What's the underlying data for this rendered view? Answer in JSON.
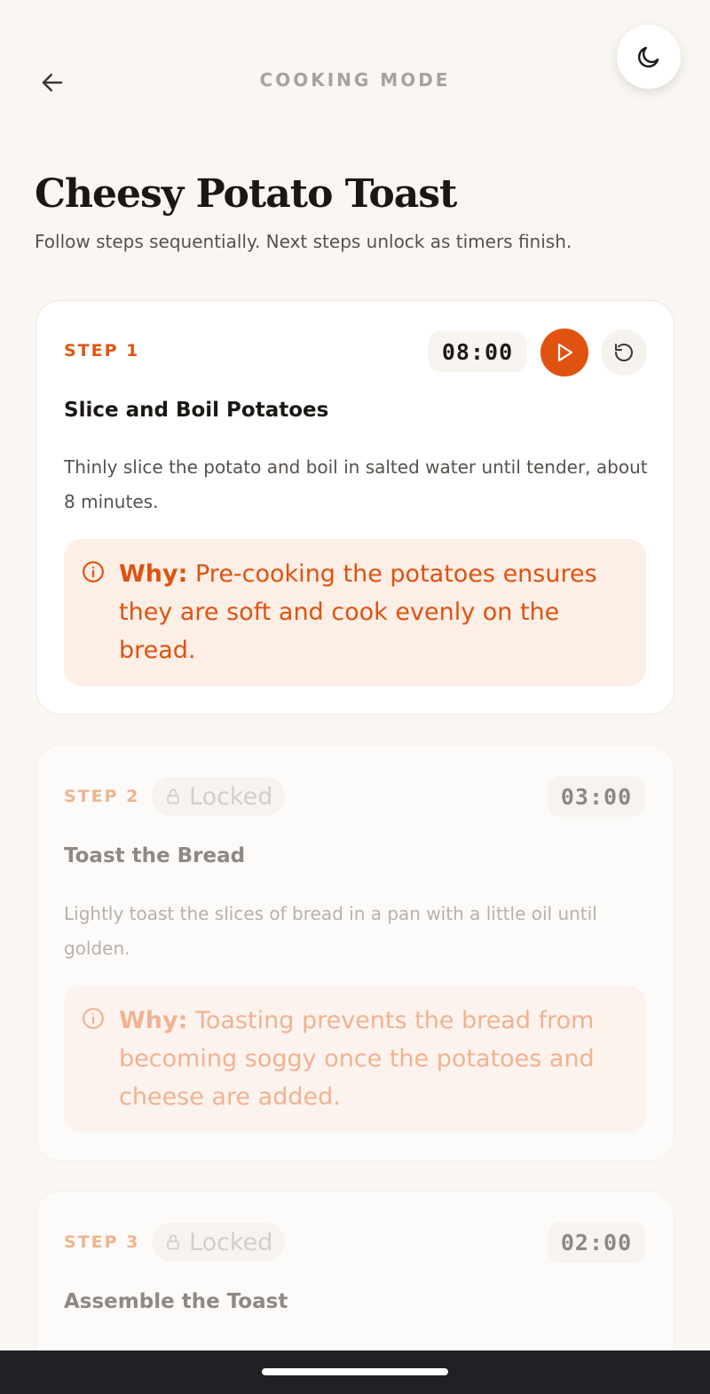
{
  "header": {
    "title": "COOKING MODE",
    "back_icon": "arrow-left-icon",
    "theme_icon": "moon-icon"
  },
  "recipe": {
    "title": "Cheesy Potato Toast",
    "subtitle": "Follow steps sequentially. Next steps unlock as timers finish."
  },
  "steps": [
    {
      "label": "STEP 1",
      "timer": "08:00",
      "title": "Slice and Boil Potatoes",
      "description": "Thinly slice the potato and boil in salted water until tender, about 8 minutes.",
      "why_label": "Why:",
      "why_text": "Pre-cooking the potatoes ensures they are soft and cook evenly on the bread."
    },
    {
      "label": "STEP 2",
      "locked_label": "Locked",
      "timer": "03:00",
      "title": "Toast the Bread",
      "description": "Lightly toast the slices of bread in a pan with a little oil until golden.",
      "why_label": "Why:",
      "why_text": "Toasting prevents the bread from becoming soggy once the potatoes and cheese are added."
    },
    {
      "label": "STEP 3",
      "locked_label": "Locked",
      "timer": "02:00",
      "title": "Assemble the Toast"
    }
  ],
  "colors": {
    "accent": "#e0520f",
    "background": "#faf7f3",
    "why_bg": "#fdeee6"
  }
}
